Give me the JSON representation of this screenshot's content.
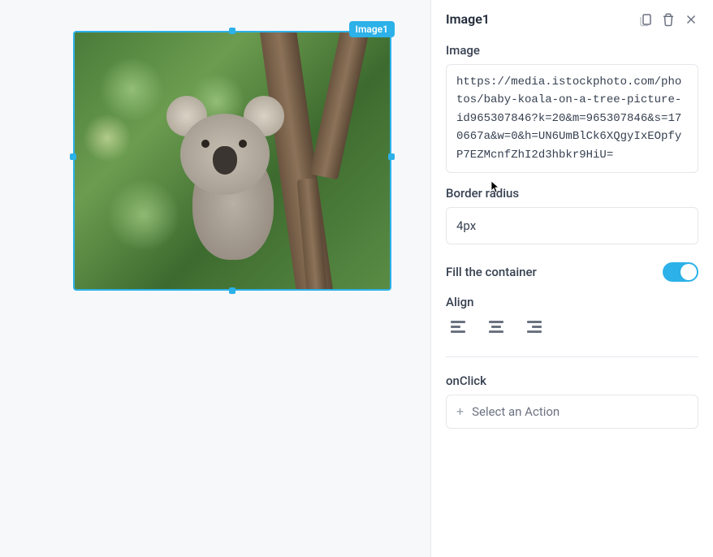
{
  "canvas": {
    "widget": {
      "label": "Image1"
    }
  },
  "panel": {
    "title": "Image1",
    "image": {
      "label": "Image",
      "value": "https://media.istockphoto.com/photos/baby-koala-on-a-tree-picture-id965307846?k=20&m=965307846&s=170667a&w=0&h=UN6UmBlCk6XQgyIxEOpfyP7EZMcnfZhI2d3hbkr9HiU="
    },
    "borderRadius": {
      "label": "Border radius",
      "value": "4px"
    },
    "fill": {
      "label": "Fill the container",
      "on": true
    },
    "align": {
      "label": "Align"
    },
    "onClick": {
      "label": "onClick",
      "placeholder": "Select an Action"
    }
  }
}
